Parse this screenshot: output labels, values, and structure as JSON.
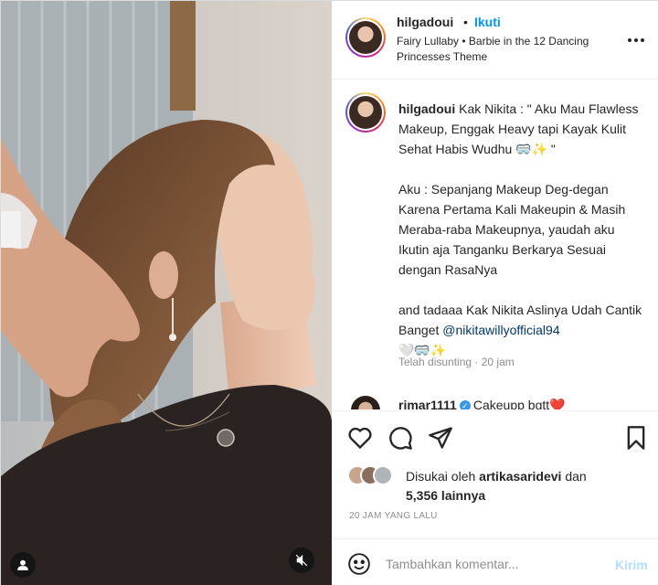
{
  "post": {
    "username": "hilgadoui",
    "dot": "•",
    "follow_label": "Ikuti",
    "audio": "Fairy Lullaby • Barbie in the 12 Dancing Princesses Theme",
    "more_icon": "more-horizontal-icon"
  },
  "caption": {
    "username": "hilgadoui",
    "paragraphs": [
      "Kak Nikita : \" Aku Mau Flawless Makeup, Enggak Heavy tapi Kayak Kulit Sehat Habis Wudhu 🥽✨ \"",
      "Aku : Sepanjang Makeup Deg-degan Karena Pertama Kali Makeupin & Masih Meraba-raba Makeupnya, yaudah aku Ikutin aja Tanganku Berkarya Sesuai dengan RasaNya",
      "and tadaaa Kak Nikita Aslinya Udah Cantik Banget "
    ],
    "mention": "@nikitawillyofficial94",
    "trailing": "🤍🥽✨",
    "meta": "Telah disunting · 20 jam"
  },
  "comment": {
    "username": "rimar1111",
    "text": "Cakeupp bgtt❤️"
  },
  "likes": {
    "prefix": "Disukai oleh ",
    "liker": "artikasaridevi",
    "and": " dan",
    "others": "5,356 lainnya"
  },
  "timestamp": "20 JAM YANG LALU",
  "comment_box": {
    "placeholder": "Tambahkan komentar...",
    "post_label": "Kirim"
  },
  "icons": [
    "heart-icon",
    "comment-icon",
    "share-icon",
    "bookmark-icon",
    "emoji-icon",
    "user-tag-icon",
    "muted-audio-icon",
    "verified-badge-icon"
  ],
  "colors": {
    "follow": "#0095f6",
    "mention": "#00376b",
    "meta": "#8e8e8e",
    "post_button_disabled": "#b2dffc",
    "verified": "#3897f0"
  }
}
